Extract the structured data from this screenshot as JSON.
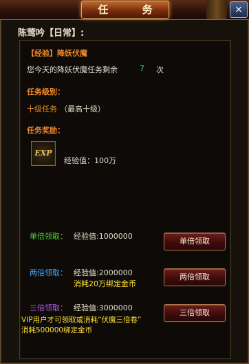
{
  "window": {
    "title": "任 务",
    "close_glyph": "×"
  },
  "npc_title": "陈莺吟【日常】:",
  "quest": {
    "name": "【经验】降妖伏魔",
    "remaining_prefix": "您今天的降妖伏魔任务剩余",
    "remaining_count": "7",
    "remaining_suffix": "次"
  },
  "level_section": {
    "heading": "任务级别：",
    "level": "十级任务",
    "note": "（最高十级）"
  },
  "reward_section": {
    "heading": "任务奖励：",
    "icon_label": "EXP",
    "exp_text": "经验值：100万"
  },
  "options": [
    {
      "label": "单倍领取：",
      "exp": "经验值:1000000",
      "cost": "",
      "button": "单倍领取"
    },
    {
      "label": "两倍领取：",
      "exp": "经验值:2000000",
      "cost": "消耗20万绑定金币",
      "button": "两倍领取"
    },
    {
      "label": "三倍领取：",
      "exp": "经验值:3000000",
      "cost": "",
      "button": "三倍领取"
    }
  ],
  "vip_note_line1": "VIP用户才可领取或消耗“伏魔三倍卷”",
  "vip_note_line2": "消耗500000绑定金币",
  "colors": {
    "accent_orange": "#f08a2a",
    "green": "#35d24a",
    "blue": "#43a8ff",
    "purple": "#b35be8",
    "yellow": "#ffe03a"
  }
}
